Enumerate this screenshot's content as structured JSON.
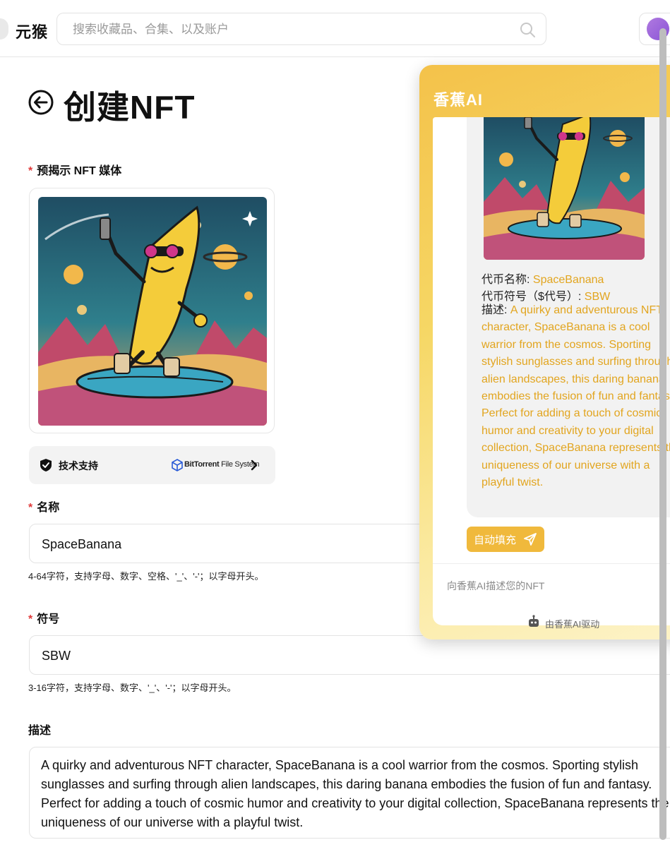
{
  "header": {
    "logo_text": "元猴",
    "search_placeholder": "搜索收藏品、合集、以及账户"
  },
  "page": {
    "title": "创建NFT",
    "media_label": "预揭示 NFT 媒体",
    "tech_support_label": "技术支持",
    "bittorrent_brand": "BitTorrent",
    "bittorrent_suffix": "File System",
    "name_label": "名称",
    "name_value": "SpaceBanana",
    "name_hint": "4-64字符，支持字母、数字、空格、'_'、'-'；以字母开头。",
    "symbol_label": "符号",
    "symbol_value": "SBW",
    "symbol_hint": "3-16字符，支持字母、数字、'_'、'-'；以字母开头。",
    "description_label": "描述",
    "description_value": "A quirky and adventurous NFT character, SpaceBanana is a cool warrior from the cosmos. Sporting stylish sunglasses and surfing through alien landscapes, this daring banana embodies the fusion of fun and fantasy. Perfect for adding a touch of cosmic humor and creativity to your digital collection, SpaceBanana represents the uniqueness of our universe with a playful twist."
  },
  "ai_panel": {
    "title": "香蕉AI",
    "token_name_key": "代币名称: ",
    "token_name_value": "SpaceBanana",
    "token_symbol_key": "代币符号（$代号）: ",
    "token_symbol_value": "SBW",
    "description_key": "描述: ",
    "description_value": "A quirky and adventurous NFT character, SpaceBanana is a cool warrior from the cosmos. Sporting stylish sunglasses and surfing through alien landscapes, this daring banana embodies the fusion of fun and fantasy. Perfect for adding a touch of cosmic humor and creativity to your digital collection, SpaceBanana represents the uniqueness of our universe with a playful twist.",
    "autofill_label": "自动填充",
    "input_placeholder": "向香蕉AI描述您的NFT",
    "powered_by": "由香蕉AI驱动"
  },
  "colors": {
    "accent_gold": "#e2a51f",
    "required_red": "#e03a3a",
    "autofill_bg": "#f0b93c"
  },
  "icons": [
    "back-arrow-icon",
    "search-icon",
    "shield-icon",
    "bittorrent-cube-icon",
    "chevron-right-icon",
    "send-icon",
    "robot-icon"
  ]
}
